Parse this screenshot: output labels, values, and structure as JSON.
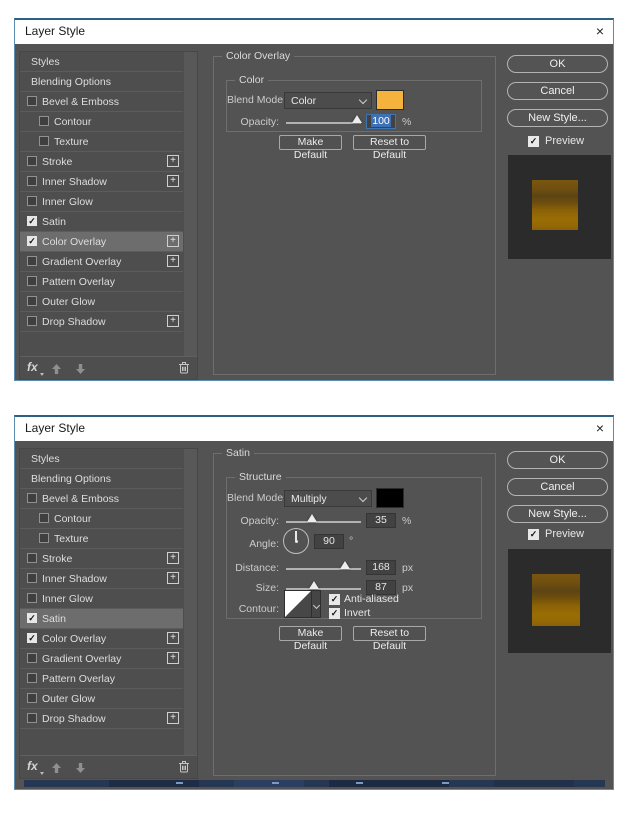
{
  "window": {
    "close_icon": "×"
  },
  "colors": {
    "dialog_border": "#5b8db0",
    "selection_blue": "#3f6fb5",
    "overlay_swatch_orange": "#f3b33d",
    "satin_swatch_black": "#000000",
    "preview_gold_top": "#7a560f",
    "preview_gold_band": "#5c4413",
    "preview_gold_bottom": "#9a6d04"
  },
  "icons": {
    "close": "close-x",
    "fx": "fx",
    "up_arrow": "move-effect-up",
    "down_arrow": "move-effect-down",
    "trash": "delete-effect",
    "plus": "add-effect-instance",
    "chevron": "dropdown-chevron",
    "check": "✓"
  },
  "dialogs": [
    {
      "title": "Layer Style",
      "sidebar": {
        "items": [
          {
            "label": "Styles",
            "checkbox": false
          },
          {
            "label": "Blending Options",
            "checkbox": false
          },
          {
            "label": "Bevel & Emboss",
            "checkbox": true,
            "checked": false
          },
          {
            "label": "Contour",
            "checkbox": true,
            "checked": false,
            "indent": true
          },
          {
            "label": "Texture",
            "checkbox": true,
            "checked": false,
            "indent": true
          },
          {
            "label": "Stroke",
            "checkbox": true,
            "checked": false,
            "plus": true
          },
          {
            "label": "Inner Shadow",
            "checkbox": true,
            "checked": false,
            "plus": true
          },
          {
            "label": "Inner Glow",
            "checkbox": true,
            "checked": false
          },
          {
            "label": "Satin",
            "checkbox": true,
            "checked": true
          },
          {
            "label": "Color Overlay",
            "checkbox": true,
            "checked": true,
            "plus": true,
            "selected": true
          },
          {
            "label": "Gradient Overlay",
            "checkbox": true,
            "checked": false,
            "plus": true
          },
          {
            "label": "Pattern Overlay",
            "checkbox": true,
            "checked": false
          },
          {
            "label": "Outer Glow",
            "checkbox": true,
            "checked": false
          },
          {
            "label": "Drop Shadow",
            "checkbox": true,
            "checked": false,
            "plus": true
          }
        ],
        "fx_label": "fx"
      },
      "panel": {
        "section_title": "Color Overlay",
        "group_title": "Color",
        "blend_mode_label": "Blend Mode:",
        "blend_mode_value": "Color",
        "swatch_color": "#f3b33d",
        "opacity_label": "Opacity:",
        "opacity_value": "100",
        "opacity_unit": "%",
        "opacity_thumb_pct": 94,
        "opacity_selected": true,
        "make_default_label": "Make Default",
        "reset_default_label": "Reset to Default"
      },
      "actions": {
        "ok_label": "OK",
        "cancel_label": "Cancel",
        "new_style_label": "New Style...",
        "preview_label": "Preview",
        "preview_checked": true
      }
    },
    {
      "title": "Layer Style",
      "sidebar": {
        "items": [
          {
            "label": "Styles",
            "checkbox": false
          },
          {
            "label": "Blending Options",
            "checkbox": false
          },
          {
            "label": "Bevel & Emboss",
            "checkbox": true,
            "checked": false
          },
          {
            "label": "Contour",
            "checkbox": true,
            "checked": false,
            "indent": true
          },
          {
            "label": "Texture",
            "checkbox": true,
            "checked": false,
            "indent": true
          },
          {
            "label": "Stroke",
            "checkbox": true,
            "checked": false,
            "plus": true
          },
          {
            "label": "Inner Shadow",
            "checkbox": true,
            "checked": false,
            "plus": true
          },
          {
            "label": "Inner Glow",
            "checkbox": true,
            "checked": false
          },
          {
            "label": "Satin",
            "checkbox": true,
            "checked": true,
            "selected": true
          },
          {
            "label": "Color Overlay",
            "checkbox": true,
            "checked": true,
            "plus": true
          },
          {
            "label": "Gradient Overlay",
            "checkbox": true,
            "checked": false,
            "plus": true
          },
          {
            "label": "Pattern Overlay",
            "checkbox": true,
            "checked": false
          },
          {
            "label": "Outer Glow",
            "checkbox": true,
            "checked": false
          },
          {
            "label": "Drop Shadow",
            "checkbox": true,
            "checked": false,
            "plus": true
          }
        ],
        "fx_label": "fx"
      },
      "panel": {
        "section_title": "Satin",
        "group_title": "Structure",
        "blend_mode_label": "Blend Mode:",
        "blend_mode_value": "Multiply",
        "swatch_color": "#000000",
        "opacity_label": "Opacity:",
        "opacity_value": "35",
        "opacity_unit": "%",
        "opacity_thumb_pct": 35,
        "angle_label": "Angle:",
        "angle_value": "90",
        "angle_unit": "°",
        "distance_label": "Distance:",
        "distance_value": "168",
        "distance_unit": "px",
        "distance_thumb_pct": 79,
        "size_label": "Size:",
        "size_value": "87",
        "size_unit": "px",
        "size_thumb_pct": 37,
        "contour_label": "Contour:",
        "anti_aliased_label": "Anti-aliased",
        "anti_aliased_checked": true,
        "invert_label": "Invert",
        "invert_checked": true,
        "make_default_label": "Make Default",
        "reset_default_label": "Reset to Default"
      },
      "actions": {
        "ok_label": "OK",
        "cancel_label": "Cancel",
        "new_style_label": "New Style...",
        "preview_label": "Preview",
        "preview_checked": true
      }
    }
  ]
}
